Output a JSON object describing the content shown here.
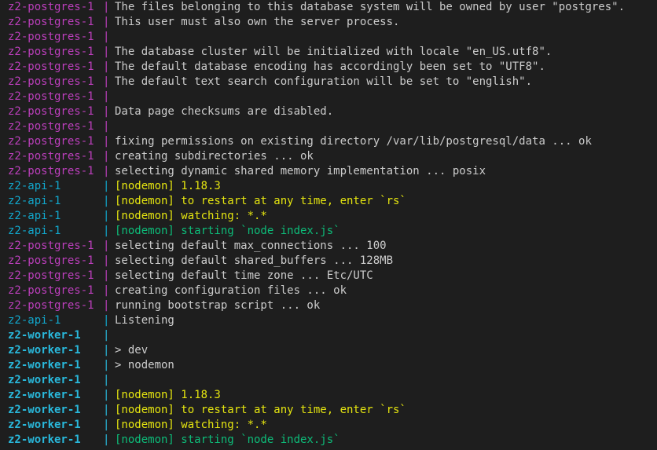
{
  "colors": {
    "background": "#1e1e1e",
    "postgres": "#bc3fbc",
    "api": "#11a8cd",
    "worker": "#29b8db",
    "text": "#cccccc",
    "yellow": "#e5e510",
    "green": "#0dbc79"
  },
  "separator": "|",
  "lines": [
    {
      "service": "z2-postgres-1",
      "kind": "postgres",
      "style": "plain",
      "text": "The files belonging to this database system will be owned by user \"postgres\"."
    },
    {
      "service": "z2-postgres-1",
      "kind": "postgres",
      "style": "plain",
      "text": "This user must also own the server process."
    },
    {
      "service": "z2-postgres-1",
      "kind": "postgres",
      "style": "plain",
      "text": ""
    },
    {
      "service": "z2-postgres-1",
      "kind": "postgres",
      "style": "plain",
      "text": "The database cluster will be initialized with locale \"en_US.utf8\"."
    },
    {
      "service": "z2-postgres-1",
      "kind": "postgres",
      "style": "plain",
      "text": "The default database encoding has accordingly been set to \"UTF8\"."
    },
    {
      "service": "z2-postgres-1",
      "kind": "postgres",
      "style": "plain",
      "text": "The default text search configuration will be set to \"english\"."
    },
    {
      "service": "z2-postgres-1",
      "kind": "postgres",
      "style": "plain",
      "text": ""
    },
    {
      "service": "z2-postgres-1",
      "kind": "postgres",
      "style": "plain",
      "text": "Data page checksums are disabled."
    },
    {
      "service": "z2-postgres-1",
      "kind": "postgres",
      "style": "plain",
      "text": ""
    },
    {
      "service": "z2-postgres-1",
      "kind": "postgres",
      "style": "plain",
      "text": "fixing permissions on existing directory /var/lib/postgresql/data ... ok"
    },
    {
      "service": "z2-postgres-1",
      "kind": "postgres",
      "style": "plain",
      "text": "creating subdirectories ... ok"
    },
    {
      "service": "z2-postgres-1",
      "kind": "postgres",
      "style": "plain",
      "text": "selecting dynamic shared memory implementation ... posix"
    },
    {
      "service": "z2-api-1",
      "kind": "api",
      "style": "yellow",
      "text": "[nodemon] 1.18.3"
    },
    {
      "service": "z2-api-1",
      "kind": "api",
      "style": "yellow",
      "text": "[nodemon] to restart at any time, enter `rs`"
    },
    {
      "service": "z2-api-1",
      "kind": "api",
      "style": "yellow",
      "text": "[nodemon] watching: *.*"
    },
    {
      "service": "z2-api-1",
      "kind": "api",
      "style": "green",
      "text": "[nodemon] starting `node index.js`"
    },
    {
      "service": "z2-postgres-1",
      "kind": "postgres",
      "style": "plain",
      "text": "selecting default max_connections ... 100"
    },
    {
      "service": "z2-postgres-1",
      "kind": "postgres",
      "style": "plain",
      "text": "selecting default shared_buffers ... 128MB"
    },
    {
      "service": "z2-postgres-1",
      "kind": "postgres",
      "style": "plain",
      "text": "selecting default time zone ... Etc/UTC"
    },
    {
      "service": "z2-postgres-1",
      "kind": "postgres",
      "style": "plain",
      "text": "creating configuration files ... ok"
    },
    {
      "service": "z2-postgres-1",
      "kind": "postgres",
      "style": "plain",
      "text": "running bootstrap script ... ok"
    },
    {
      "service": "z2-api-1",
      "kind": "api",
      "style": "plain",
      "text": "Listening"
    },
    {
      "service": "z2-worker-1",
      "kind": "worker",
      "style": "plain",
      "text": ""
    },
    {
      "service": "z2-worker-1",
      "kind": "worker",
      "style": "plain",
      "text": "> dev"
    },
    {
      "service": "z2-worker-1",
      "kind": "worker",
      "style": "plain",
      "text": "> nodemon"
    },
    {
      "service": "z2-worker-1",
      "kind": "worker",
      "style": "plain",
      "text": ""
    },
    {
      "service": "z2-worker-1",
      "kind": "worker",
      "style": "yellow",
      "text": "[nodemon] 1.18.3"
    },
    {
      "service": "z2-worker-1",
      "kind": "worker",
      "style": "yellow",
      "text": "[nodemon] to restart at any time, enter `rs`"
    },
    {
      "service": "z2-worker-1",
      "kind": "worker",
      "style": "yellow",
      "text": "[nodemon] watching: *.*"
    },
    {
      "service": "z2-worker-1",
      "kind": "worker",
      "style": "green",
      "text": "[nodemon] starting `node index.js`"
    }
  ]
}
